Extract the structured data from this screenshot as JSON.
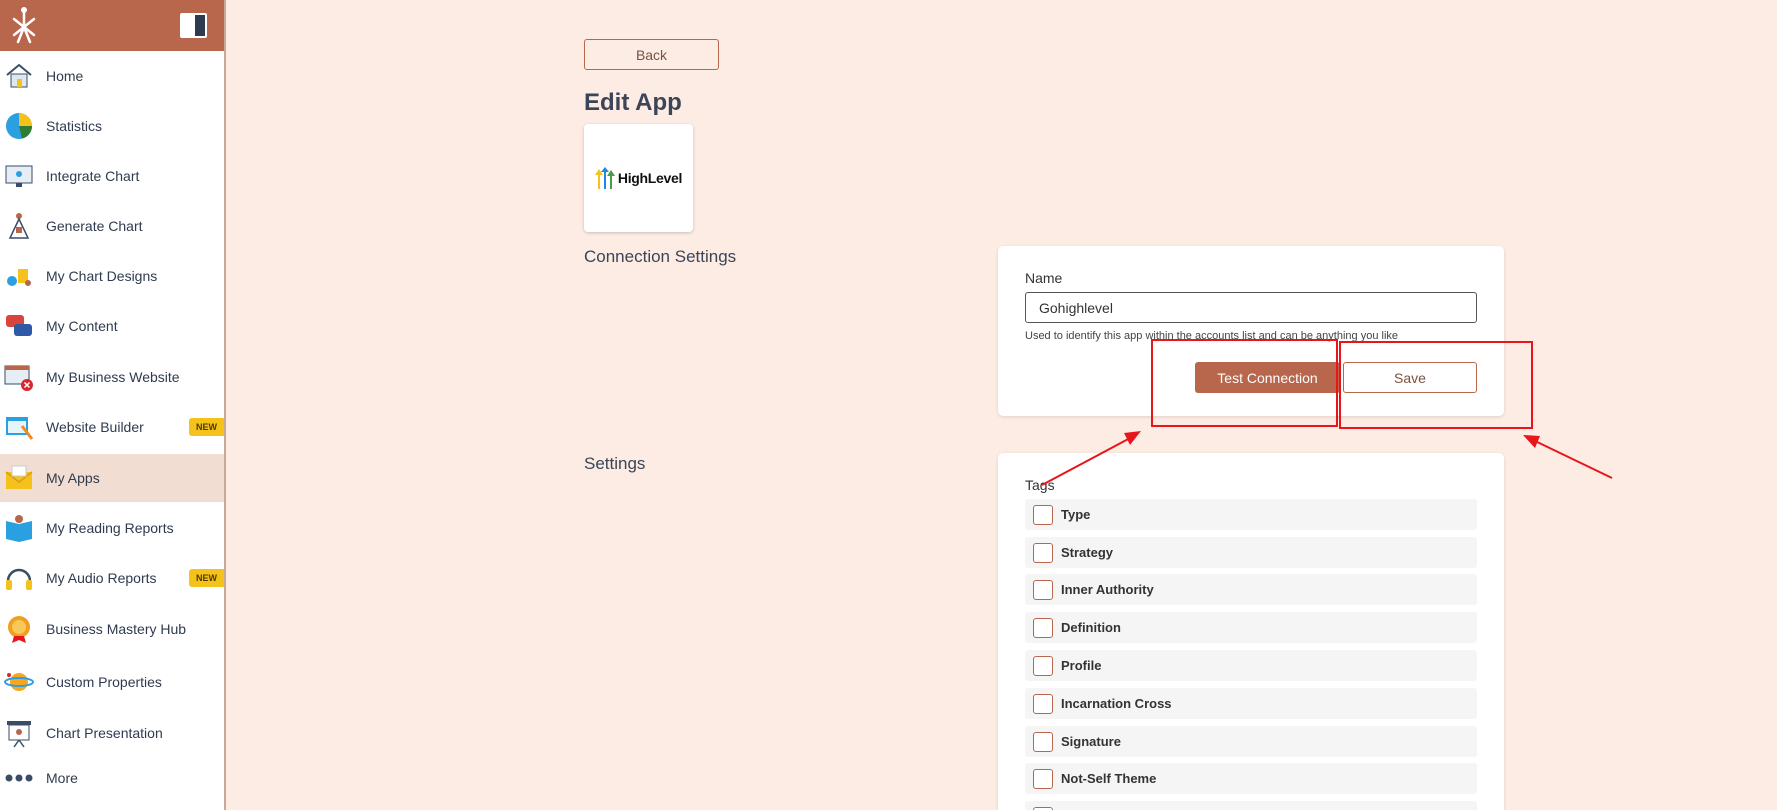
{
  "sidebar": {
    "items": [
      {
        "label": "Home",
        "icon": "home-icon"
      },
      {
        "label": "Statistics",
        "icon": "pie-chart-icon"
      },
      {
        "label": "Integrate Chart",
        "icon": "monitor-chart-icon"
      },
      {
        "label": "Generate Chart",
        "icon": "bodygraph-icon"
      },
      {
        "label": "My Chart Designs",
        "icon": "designs-icon"
      },
      {
        "label": "My Content",
        "icon": "content-bubbles-icon"
      },
      {
        "label": "My Business Website",
        "icon": "website-error-icon"
      },
      {
        "label": "Website Builder",
        "icon": "builder-icon",
        "badge": "NEW"
      },
      {
        "label": "My Apps",
        "icon": "apps-envelope-icon",
        "active": true
      },
      {
        "label": "My Reading Reports",
        "icon": "reading-report-icon"
      },
      {
        "label": "My Audio Reports",
        "icon": "headphones-icon",
        "badge": "NEW"
      },
      {
        "label": "Business Mastery Hub",
        "icon": "medal-icon"
      },
      {
        "label": "Custom Properties",
        "icon": "planet-icon"
      },
      {
        "label": "Chart Presentation",
        "icon": "presentation-icon"
      },
      {
        "label": "More",
        "icon": "more-dots-icon"
      }
    ]
  },
  "main": {
    "back_label": "Back",
    "title": "Edit App",
    "app_logo_text": "HighLevel",
    "connection_heading": "Connection Settings",
    "settings_heading": "Settings",
    "connection": {
      "name_label": "Name",
      "name_value": "Gohighlevel",
      "help_text": "Used to identify this app within the accounts list and can be anything you like",
      "test_label": "Test Connection",
      "save_label": "Save"
    },
    "tags": {
      "label": "Tags",
      "items": [
        "Type",
        "Strategy",
        "Inner Authority",
        "Definition",
        "Profile",
        "Incarnation Cross",
        "Signature",
        "Not-Self Theme"
      ]
    }
  },
  "colors": {
    "accent": "#b8664c",
    "background": "#fcece3",
    "annotation": "#e8161b",
    "badge": "#f5c21b"
  }
}
